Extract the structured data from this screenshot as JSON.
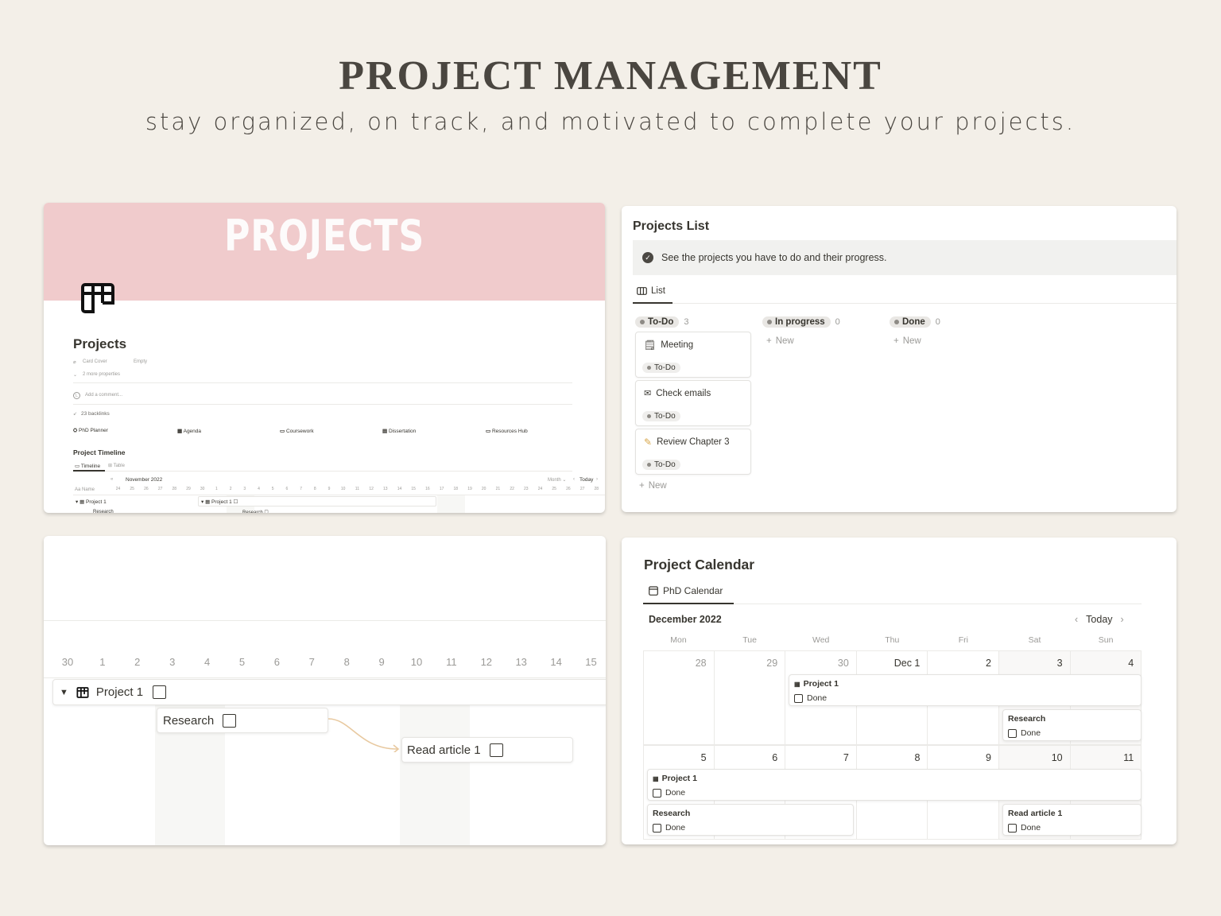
{
  "header": {
    "title": "PROJECT MANAGEMENT",
    "subtitle": "stay organized, on track, and motivated to complete your projects."
  },
  "projects_page": {
    "cover_title": "PROJECTS",
    "page_icon": "kanban-board-icon",
    "title": "Projects",
    "properties": {
      "card_cover_label": "Card Cover",
      "card_cover_value": "Empty",
      "more_properties": "2 more properties"
    },
    "comment_placeholder": "Add a comment...",
    "backlinks": "23 backlinks",
    "links": [
      {
        "label": "PhD Planner",
        "icon": "graduation-cap-icon"
      },
      {
        "label": "Agenda",
        "icon": "calendar-icon"
      },
      {
        "label": "Coursework",
        "icon": "laptop-icon"
      },
      {
        "label": "Dissertation",
        "icon": "scroll-icon"
      },
      {
        "label": "Resources Hub",
        "icon": "folder-icon"
      }
    ],
    "timeline": {
      "heading": "Project Timeline",
      "tabs": [
        "Timeline",
        "Table"
      ],
      "month": "November 2022",
      "view_select": "Month",
      "today_label": "Today",
      "name_column": "Name",
      "days": [
        "24",
        "25",
        "26",
        "27",
        "28",
        "29",
        "30",
        "1",
        "2",
        "3",
        "4",
        "5",
        "6",
        "7",
        "8",
        "9",
        "10",
        "11",
        "12",
        "13",
        "14",
        "15",
        "16",
        "17",
        "18",
        "19",
        "20",
        "21",
        "22",
        "23",
        "24",
        "25",
        "26",
        "27",
        "28"
      ],
      "rows": [
        {
          "name": "Project 1"
        },
        {
          "name": "Research"
        }
      ]
    }
  },
  "projects_list": {
    "title": "Projects List",
    "callout": "See the projects you have to do and their progress.",
    "view_tab": "List",
    "columns": [
      {
        "status": "To-Do",
        "count": "3",
        "cards": [
          {
            "name": "Meeting",
            "icon": "notepad-icon",
            "status": "To-Do"
          },
          {
            "name": "Check emails",
            "icon": "envelope-icon",
            "status": "To-Do"
          },
          {
            "name": "Review Chapter 3",
            "icon": "pencil-icon",
            "status": "To-Do"
          }
        ]
      },
      {
        "status": "In progress",
        "count": "0",
        "cards": []
      },
      {
        "status": "Done",
        "count": "0",
        "cards": []
      }
    ],
    "new_label": "New"
  },
  "timeline_zoom": {
    "days": [
      "30",
      "1",
      "2",
      "3",
      "4",
      "5",
      "6",
      "7",
      "8",
      "9",
      "10",
      "11",
      "12",
      "13",
      "14",
      "15"
    ],
    "items": [
      {
        "name": "Project 1",
        "start_day": "30",
        "end_day": "15"
      },
      {
        "name": "Research",
        "start_day": "3",
        "end_day": "7"
      },
      {
        "name": "Read article 1",
        "start_day": "10",
        "end_day": "14"
      }
    ],
    "dependency": {
      "from": "Research",
      "to": "Read article 1",
      "color": "#e8c9a0"
    }
  },
  "calendar": {
    "title": "Project Calendar",
    "view_tab": "PhD Calendar",
    "month": "December 2022",
    "today_label": "Today",
    "weekdays": [
      "Mon",
      "Tue",
      "Wed",
      "Thu",
      "Fri",
      "Sat",
      "Sun"
    ],
    "weeks": [
      [
        "28",
        "29",
        "30",
        "Dec 1",
        "2",
        "3",
        "4"
      ],
      [
        "5",
        "6",
        "7",
        "8",
        "9",
        "10",
        "11"
      ]
    ],
    "events": [
      {
        "name": "Project 1",
        "prop": "Done",
        "icon": true
      },
      {
        "name": "Research",
        "prop": "Done",
        "icon": false
      },
      {
        "name": "Project 1",
        "prop": "Done",
        "icon": true
      },
      {
        "name": "Research",
        "prop": "Done",
        "icon": false
      },
      {
        "name": "Read article 1",
        "prop": "Done",
        "icon": false
      }
    ]
  }
}
